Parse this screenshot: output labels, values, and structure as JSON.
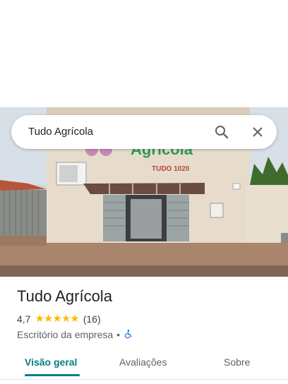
{
  "search": {
    "query": "Tudo Agrícola"
  },
  "icons": {
    "search": "search-icon",
    "close": "close-icon",
    "accessibility": "wheelchair-accessible-icon"
  },
  "photo": {
    "sign_text": "Agrícola",
    "sign_subtext": "TUDO 1020"
  },
  "place": {
    "name": "Tudo Agrícola",
    "rating": "4,7",
    "rating_value": 4.7,
    "review_count": "(16)",
    "category": "Escritório da empresa",
    "separator": "•"
  },
  "tabs": [
    {
      "label": "Visão geral",
      "active": true
    },
    {
      "label": "Avaliações",
      "active": false
    },
    {
      "label": "Sobre",
      "active": false
    }
  ],
  "colors": {
    "accent": "#017e84",
    "star": "#fbbc04",
    "accessibility": "#1a73e8"
  }
}
